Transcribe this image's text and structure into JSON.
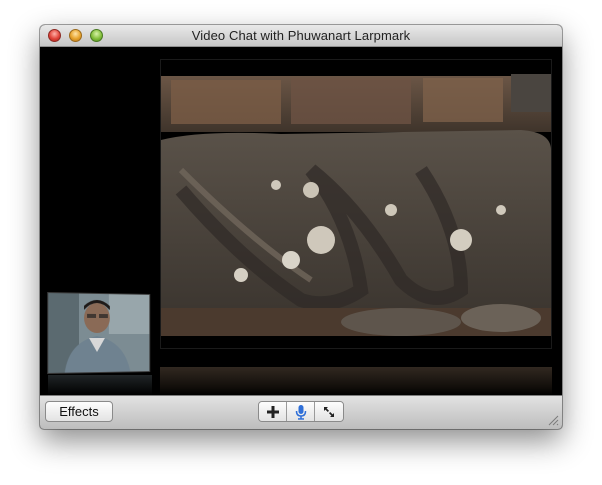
{
  "window": {
    "title": "Video Chat with Phuwanart Larpmark"
  },
  "toolbar": {
    "effects_label": "Effects",
    "buttons": [
      {
        "name": "add-participant",
        "icon": "plus-icon"
      },
      {
        "name": "microphone",
        "icon": "microphone-icon"
      },
      {
        "name": "fullscreen",
        "icon": "fullscreen-arrows-icon"
      }
    ]
  },
  "colors": {
    "titlebar_top": "#e9e9e9",
    "titlebar_bottom": "#c6c6c6",
    "video_bg": "#000000",
    "mic_blue": "#2f6fd8"
  }
}
